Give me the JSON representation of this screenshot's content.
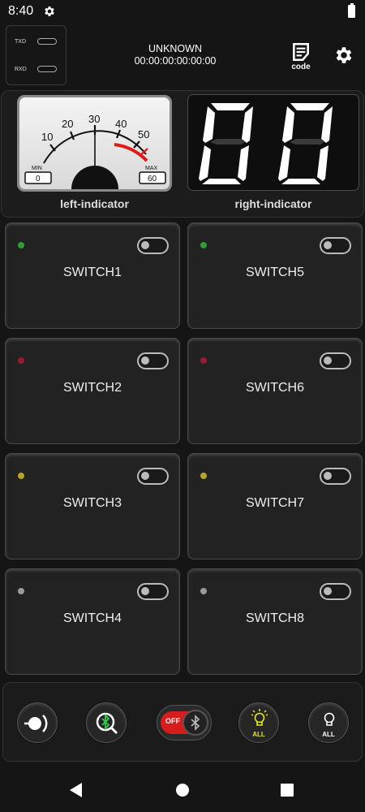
{
  "status_bar": {
    "time": "8:40"
  },
  "header": {
    "comm": {
      "txd_label": "TXD",
      "rxd_label": "RXD"
    },
    "device_name": "UNKNOWN",
    "device_address": "00:00:00:00:00:00",
    "code_label": "code"
  },
  "indicators": {
    "left": {
      "label": "left-indicator",
      "ticks": [
        "10",
        "20",
        "30",
        "40",
        "50"
      ],
      "min_label": "MIN",
      "max_label": "MAX",
      "min_value": "0",
      "max_value": "60"
    },
    "right": {
      "label": "right-indicator",
      "display": "00"
    }
  },
  "switches": [
    {
      "label": "SWITCH1",
      "led_color": "#2e9e33"
    },
    {
      "label": "SWITCH2",
      "led_color": "#9a1a35"
    },
    {
      "label": "SWITCH3",
      "led_color": "#b5a42a"
    },
    {
      "label": "SWITCH4",
      "led_color": "#9a9a9a"
    },
    {
      "label": "SWITCH5",
      "led_color": "#2e9e33"
    },
    {
      "label": "SWITCH6",
      "led_color": "#9a1a35"
    },
    {
      "label": "SWITCH7",
      "led_color": "#b5a42a"
    },
    {
      "label": "SWITCH8",
      "led_color": "#9a9a9a"
    }
  ],
  "bottom_bar": {
    "bluetooth_toggle_label": "OFF",
    "all_on_label": "ALL",
    "all_off_label": "ALL",
    "accent_green": "#2fd14a",
    "accent_yellow": "#e6e62b",
    "accent_red": "#d81c1c"
  }
}
